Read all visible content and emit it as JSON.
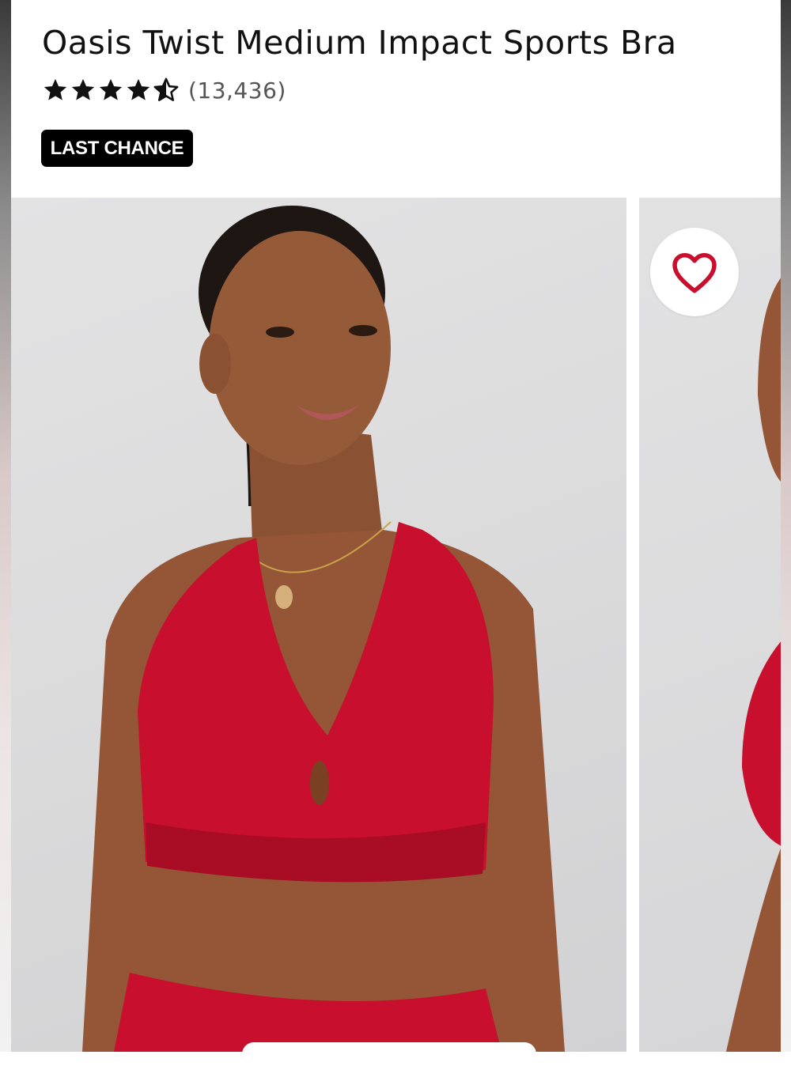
{
  "product": {
    "title": "Oasis Twist Medium Impact Sports Bra",
    "rating": {
      "stars": 4.5,
      "max_stars": 5,
      "review_count_text": "(13,436)"
    },
    "badge_label": "LAST CHANCE"
  },
  "gallery": {
    "images": [
      {
        "description_icon": "product-photo"
      },
      {
        "description_icon": "product-photo"
      }
    ],
    "favorite_icon": "heart-outline-icon"
  },
  "colors": {
    "accent_red": "#c8102e",
    "badge_bg": "#000000",
    "star_fill": "#111111"
  }
}
